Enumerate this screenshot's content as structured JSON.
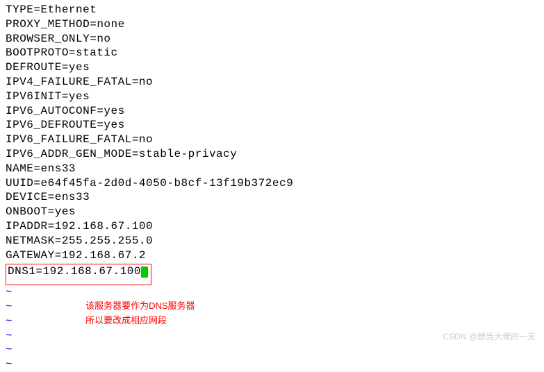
{
  "config": {
    "lines": [
      "TYPE=Ethernet",
      "PROXY_METHOD=none",
      "BROWSER_ONLY=no",
      "BOOTPROTO=static",
      "DEFROUTE=yes",
      "IPV4_FAILURE_FATAL=no",
      "IPV6INIT=yes",
      "IPV6_AUTOCONF=yes",
      "IPV6_DEFROUTE=yes",
      "IPV6_FAILURE_FATAL=no",
      "IPV6_ADDR_GEN_MODE=stable-privacy",
      "NAME=ens33",
      "UUID=e64f45fa-2d0d-4050-b8cf-13f19b372ec9",
      "DEVICE=ens33",
      "ONBOOT=yes",
      "IPADDR=192.168.67.100",
      "NETMASK=255.255.255.0",
      "GATEWAY=192.168.67.2"
    ],
    "highlighted": "DNS1=192.168.67.100"
  },
  "tilde": "~",
  "annotation": {
    "line1": "该服务器要作为DNS服务器",
    "line2": "所以要改成相应网段"
  },
  "watermark": "CSDN @想当大佬的一天"
}
